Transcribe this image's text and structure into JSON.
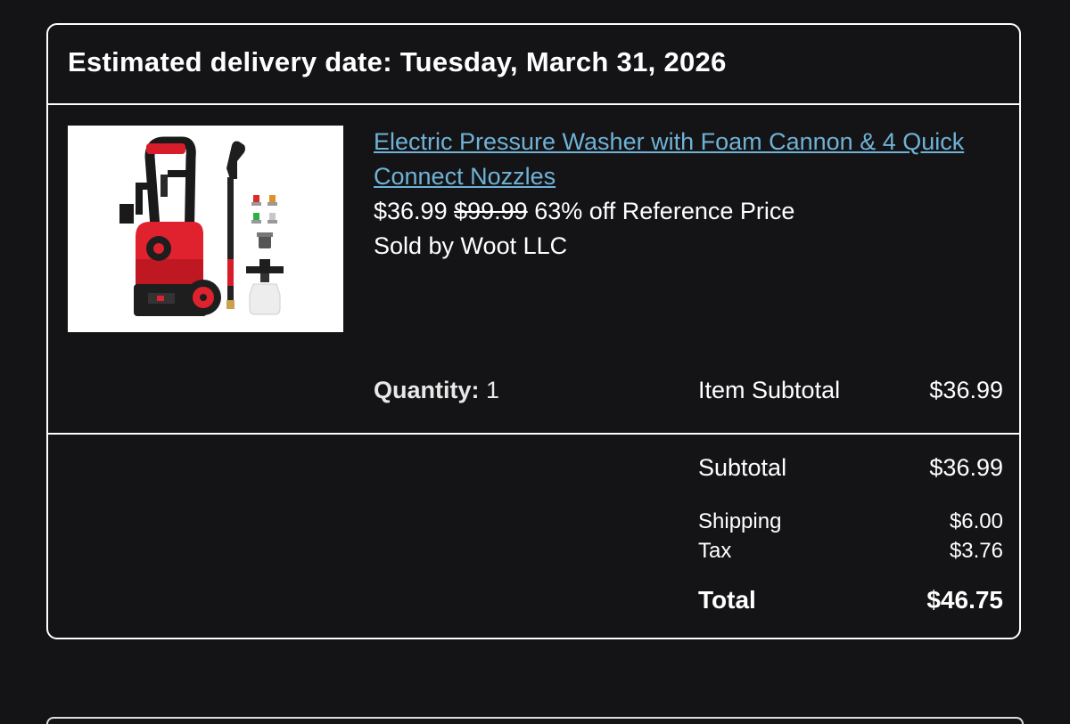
{
  "header": {
    "title": "Estimated delivery date: Tuesday, March 31, 2026"
  },
  "item": {
    "title": "Electric Pressure Washer with Foam Cannon & 4 Quick Connect Nozzles",
    "price": "$36.99",
    "original_price": "$99.99",
    "discount": "63% off Reference Price",
    "seller": "Sold by Woot LLC",
    "quantity_label": "Quantity:",
    "quantity": "1",
    "subtotal_label": "Item Subtotal",
    "subtotal_value": "$36.99"
  },
  "totals": {
    "subtotal_label": "Subtotal",
    "subtotal_value": "$36.99",
    "shipping_label": "Shipping",
    "shipping_value": "$6.00",
    "tax_label": "Tax",
    "tax_value": "$3.76",
    "total_label": "Total",
    "total_value": "$46.75"
  },
  "colors": {
    "background": "#141416",
    "link": "#6fb2d6",
    "border": "#ffffff"
  }
}
